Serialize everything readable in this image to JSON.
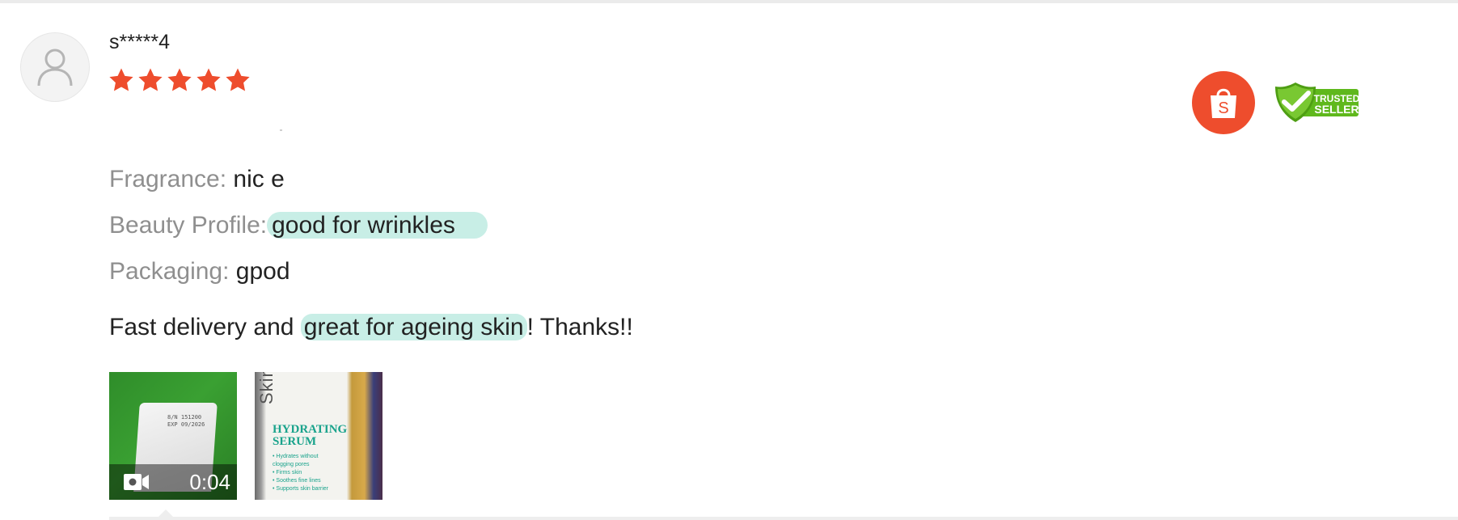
{
  "review": {
    "username": "s*****4",
    "rating": 5,
    "rating_max": 5,
    "star_color": "#ee4d2d",
    "attributes": [
      {
        "label": "Fragrance:",
        "value": "nic e"
      },
      {
        "label": "Beauty Profile:",
        "value": "good for wrinkles"
      },
      {
        "label": "Packaging:",
        "value": "gpod"
      }
    ],
    "comment": {
      "before": "Fast delivery and ",
      "highlight": "great for ageing skin",
      "after": "! Thanks!!"
    },
    "highlight_color": "#c8eee6",
    "media": {
      "video_duration": "0:04",
      "video_print_line1": "8/N 151200",
      "video_print_line2": "EXP 09/2026",
      "product_side_text": "Skin",
      "product_title_line1": "HYDRATING",
      "product_title_line2": "SERUM",
      "product_bullets": [
        "• Hydrates without",
        "  clogging pores",
        "• Firms skin",
        "• Soothes fine lines",
        "• Supports skin barrier"
      ]
    }
  },
  "badges": {
    "shopee_letter": "S",
    "shopee_color": "#ee4d2d",
    "trusted_line1": "TRUSTED",
    "trusted_line2": "SELLER",
    "trusted_color": "#5fb81c"
  },
  "icons": {
    "avatar": "user-silhouette-icon",
    "star": "star-icon",
    "video": "video-camera-icon",
    "shopee": "shopping-bag-icon",
    "trusted": "shield-check-icon"
  }
}
